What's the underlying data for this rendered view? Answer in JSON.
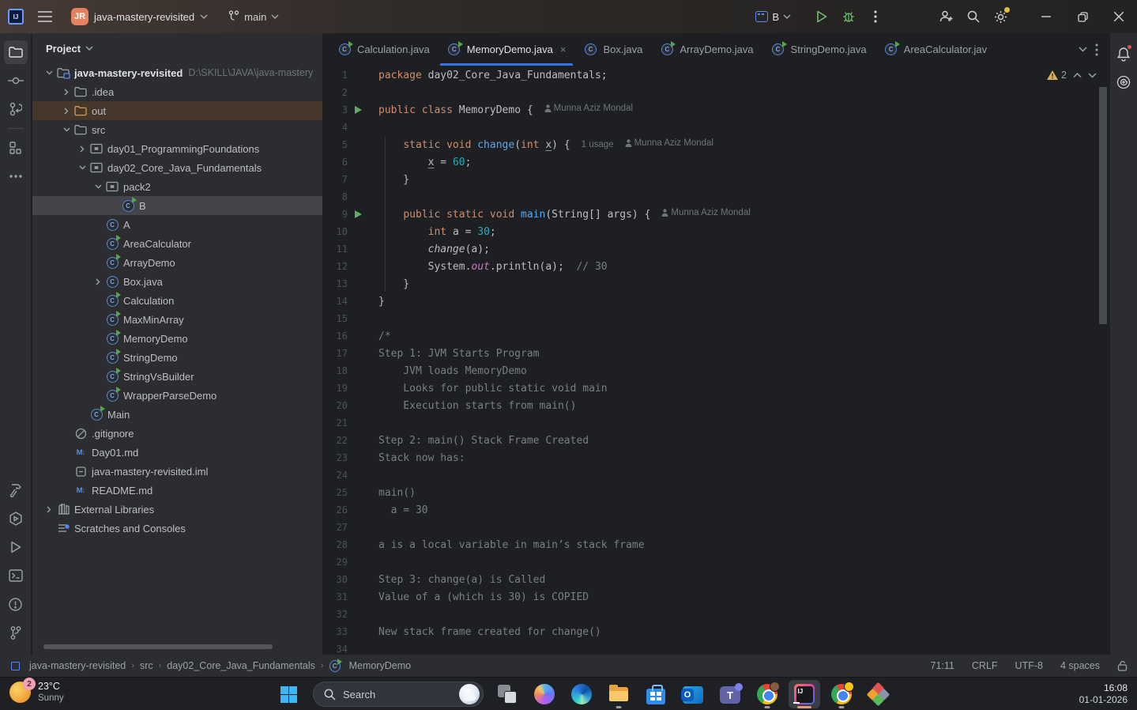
{
  "colors": {
    "accent": "#3574f0",
    "keyword": "#cf8e6d",
    "number": "#2aacb8",
    "method": "#56a8f5",
    "comment": "#7a7e85",
    "field": "#c77dbb",
    "warning": "#d6ae58",
    "selection": "#43454a",
    "out_highlight": "#45372a"
  },
  "title_bar": {
    "avatar_initials": "JR",
    "project_name": "java-mastery-revisited",
    "branch": "main",
    "run_config": "B"
  },
  "tabs": {
    "items": [
      {
        "label": "Calculation.java",
        "icon": "class-run",
        "active": false
      },
      {
        "label": "MemoryDemo.java",
        "icon": "class-run",
        "active": true,
        "closable": true
      },
      {
        "label": "Box.java",
        "icon": "class",
        "active": false
      },
      {
        "label": "ArrayDemo.java",
        "icon": "class-run",
        "active": false
      },
      {
        "label": "StringDemo.java",
        "icon": "class-run",
        "active": false
      },
      {
        "label": "AreaCalculator.jav",
        "icon": "class-run",
        "active": false
      }
    ]
  },
  "project_panel": {
    "header": "Project",
    "tree": [
      {
        "label": "java-mastery-revisited",
        "path": "D:\\SKILL\\JAVA\\java-mastery",
        "level": 0,
        "chevron": "open",
        "icon": "folder-project",
        "root": true
      },
      {
        "label": ".idea",
        "level": 1,
        "chevron": "closed",
        "icon": "folder"
      },
      {
        "label": "out",
        "level": 1,
        "chevron": "closed",
        "icon": "folder-excluded",
        "state": "highlight"
      },
      {
        "label": "src",
        "level": 1,
        "chevron": "open",
        "icon": "folder"
      },
      {
        "label": "day01_ProgrammingFoundations",
        "level": 2,
        "chevron": "closed",
        "icon": "package"
      },
      {
        "label": "day02_Core_Java_Fundamentals",
        "level": 2,
        "chevron": "open",
        "icon": "package"
      },
      {
        "label": "pack2",
        "level": 3,
        "chevron": "open",
        "icon": "package"
      },
      {
        "label": "B",
        "level": 4,
        "chevron": null,
        "icon": "class-run",
        "state": "selected"
      },
      {
        "label": "A",
        "level": 3,
        "chevron": null,
        "icon": "class"
      },
      {
        "label": "AreaCalculator",
        "level": 3,
        "chevron": null,
        "icon": "class-run"
      },
      {
        "label": "ArrayDemo",
        "level": 3,
        "chevron": null,
        "icon": "class-run"
      },
      {
        "label": "Box.java",
        "level": 3,
        "chevron": "closed",
        "icon": "class"
      },
      {
        "label": "Calculation",
        "level": 3,
        "chevron": null,
        "icon": "class-run"
      },
      {
        "label": "MaxMinArray",
        "level": 3,
        "chevron": null,
        "icon": "class-run"
      },
      {
        "label": "MemoryDemo",
        "level": 3,
        "chevron": null,
        "icon": "class-run"
      },
      {
        "label": "StringDemo",
        "level": 3,
        "chevron": null,
        "icon": "class-run"
      },
      {
        "label": "StringVsBuilder",
        "level": 3,
        "chevron": null,
        "icon": "class-run"
      },
      {
        "label": "WrapperParseDemo",
        "level": 3,
        "chevron": null,
        "icon": "class-run"
      },
      {
        "label": "Main",
        "level": 2,
        "chevron": null,
        "icon": "class-run"
      },
      {
        "label": ".gitignore",
        "level": 1,
        "chevron": null,
        "icon": "ignore"
      },
      {
        "label": "Day01.md",
        "level": 1,
        "chevron": null,
        "icon": "markdown"
      },
      {
        "label": "java-mastery-revisited.iml",
        "level": 1,
        "chevron": null,
        "icon": "iml"
      },
      {
        "label": "README.md",
        "level": 1,
        "chevron": null,
        "icon": "markdown"
      },
      {
        "label": "External Libraries",
        "level": 0,
        "chevron": "closed",
        "icon": "lib"
      },
      {
        "label": "Scratches and Consoles",
        "level": 0,
        "chevron": null,
        "icon": "scratch"
      }
    ]
  },
  "editor": {
    "warning_count": "2",
    "author_hint": "Munna Aziz Mondal",
    "usage_hint": "1 usage",
    "lines": [
      {
        "n": 1,
        "seg": [
          [
            "k",
            "package "
          ],
          [
            "t",
            "day02_Core_Java_Fundamentals;"
          ]
        ]
      },
      {
        "n": 2,
        "seg": []
      },
      {
        "n": 3,
        "run": true,
        "seg": [
          [
            "k",
            "public class "
          ],
          [
            "t",
            "MemoryDemo {"
          ]
        ],
        "hints": [
          [
            "author",
            "Munna Aziz Mondal"
          ]
        ]
      },
      {
        "n": 4,
        "seg": []
      },
      {
        "n": 5,
        "seg": [
          [
            "t",
            "    "
          ],
          [
            "k",
            "static void "
          ],
          [
            "m",
            "change"
          ],
          [
            "t",
            "("
          ],
          [
            "k",
            "int "
          ],
          [
            "p",
            "x"
          ],
          [
            "t",
            ") {"
          ]
        ],
        "hints": [
          [
            "usage",
            "1 usage"
          ],
          [
            "author",
            "Munna Aziz Mondal"
          ]
        ]
      },
      {
        "n": 6,
        "seg": [
          [
            "t",
            "        "
          ],
          [
            "p",
            "x"
          ],
          [
            "t",
            " = "
          ],
          [
            "n",
            "60"
          ],
          [
            "t",
            ";"
          ]
        ]
      },
      {
        "n": 7,
        "seg": [
          [
            "t",
            "    }"
          ]
        ]
      },
      {
        "n": 8,
        "seg": []
      },
      {
        "n": 9,
        "run": true,
        "seg": [
          [
            "t",
            "    "
          ],
          [
            "k",
            "public static void "
          ],
          [
            "m",
            "main"
          ],
          [
            "t",
            "(String[] args) {"
          ]
        ],
        "hints": [
          [
            "author",
            "Munna Aziz Mondal"
          ]
        ]
      },
      {
        "n": 10,
        "seg": [
          [
            "t",
            "        "
          ],
          [
            "k",
            "int "
          ],
          [
            "t",
            "a = "
          ],
          [
            "n",
            "30"
          ],
          [
            "t",
            ";"
          ]
        ]
      },
      {
        "n": 11,
        "seg": [
          [
            "t",
            "        "
          ],
          [
            "mi",
            "change"
          ],
          [
            "t",
            "(a);"
          ]
        ]
      },
      {
        "n": 12,
        "seg": [
          [
            "t",
            "        System."
          ],
          [
            "f",
            "out"
          ],
          [
            "t",
            ".println(a);  "
          ],
          [
            "c",
            "// 30"
          ]
        ]
      },
      {
        "n": 13,
        "seg": [
          [
            "t",
            "    }"
          ]
        ]
      },
      {
        "n": 14,
        "seg": [
          [
            "t",
            "}"
          ]
        ]
      },
      {
        "n": 15,
        "seg": []
      },
      {
        "n": 16,
        "seg": [
          [
            "c",
            "/*"
          ]
        ]
      },
      {
        "n": 17,
        "seg": [
          [
            "c",
            "Step 1: JVM Starts Program"
          ]
        ]
      },
      {
        "n": 18,
        "seg": [
          [
            "c",
            "    JVM loads MemoryDemo"
          ]
        ]
      },
      {
        "n": 19,
        "seg": [
          [
            "c",
            "    Looks for public static void main"
          ]
        ]
      },
      {
        "n": 20,
        "seg": [
          [
            "c",
            "    Execution starts from main()"
          ]
        ]
      },
      {
        "n": 21,
        "seg": []
      },
      {
        "n": 22,
        "seg": [
          [
            "c",
            "Step 2: main() Stack Frame Created"
          ]
        ]
      },
      {
        "n": 23,
        "seg": [
          [
            "c",
            "Stack now has:"
          ]
        ]
      },
      {
        "n": 24,
        "seg": []
      },
      {
        "n": 25,
        "seg": [
          [
            "c",
            "main()"
          ]
        ]
      },
      {
        "n": 26,
        "seg": [
          [
            "c",
            "  a = 30"
          ]
        ]
      },
      {
        "n": 27,
        "seg": []
      },
      {
        "n": 28,
        "seg": [
          [
            "c",
            "a is a local variable in main’s stack frame"
          ]
        ]
      },
      {
        "n": 29,
        "seg": []
      },
      {
        "n": 30,
        "seg": [
          [
            "c",
            "Step 3: change(a) is Called"
          ]
        ]
      },
      {
        "n": 31,
        "seg": [
          [
            "c",
            "Value of a (which is 30) is COPIED"
          ]
        ]
      },
      {
        "n": 32,
        "seg": []
      },
      {
        "n": 33,
        "seg": [
          [
            "c",
            "New stack frame created for change()"
          ]
        ]
      },
      {
        "n": 34,
        "seg": []
      }
    ]
  },
  "status_bar": {
    "breadcrumbs": [
      {
        "label": "java-mastery-revisited",
        "icon": "module"
      },
      {
        "label": "src"
      },
      {
        "label": "day02_Core_Java_Fundamentals"
      },
      {
        "label": "MemoryDemo",
        "icon": "class-run"
      }
    ],
    "caret": "71:11",
    "line_separator": "CRLF",
    "encoding": "UTF-8",
    "indent": "4 spaces"
  },
  "taskbar": {
    "weather": {
      "badge": "2",
      "temp": "23°C",
      "condition": "Sunny"
    },
    "search_placeholder": "Search",
    "apps": [
      {
        "name": "task-view"
      },
      {
        "name": "copilot"
      },
      {
        "name": "edge"
      },
      {
        "name": "file-explorer",
        "running": true
      },
      {
        "name": "microsoft-store"
      },
      {
        "name": "outlook"
      },
      {
        "name": "teams"
      },
      {
        "name": "chrome-profile-1",
        "running": true
      },
      {
        "name": "intellij-idea",
        "running": true,
        "active": true
      },
      {
        "name": "chrome-profile-2",
        "running": true
      },
      {
        "name": "diamond-app"
      }
    ],
    "clock": {
      "time": "16:08",
      "date": "01-01-2026"
    }
  }
}
